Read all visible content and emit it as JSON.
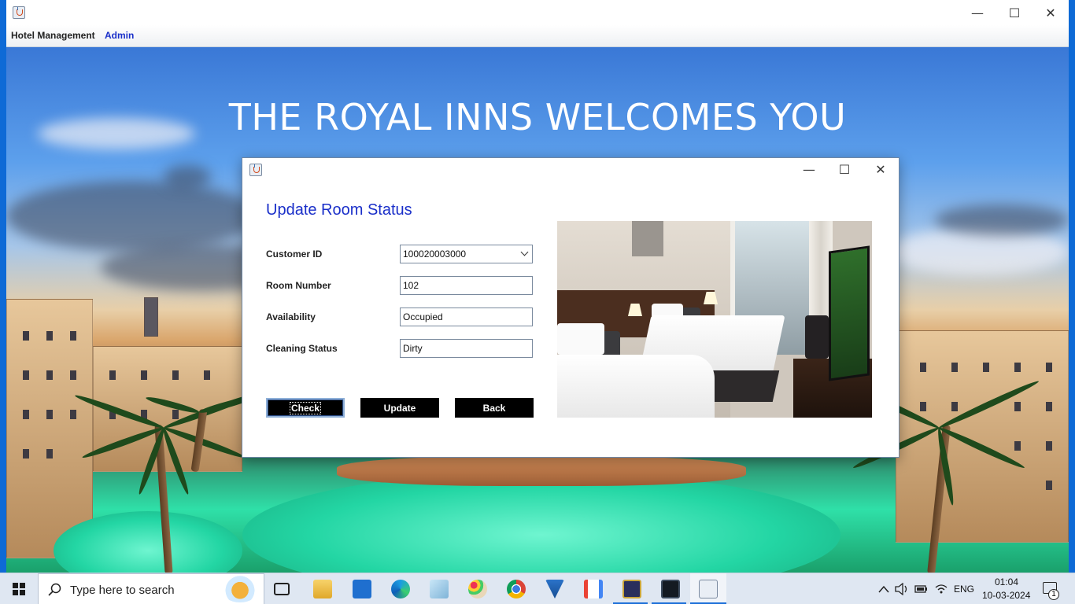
{
  "app": {
    "menu": {
      "hotel_management": "Hotel Management",
      "admin": "Admin"
    },
    "controls": {
      "minimize": "—",
      "maximize": "☐",
      "close": "✕"
    }
  },
  "banner": {
    "welcome": "THE ROYAL INNS WELCOMES YOU"
  },
  "dialog": {
    "controls": {
      "minimize": "—",
      "maximize": "☐",
      "close": "✕"
    },
    "title": "Update Room Status",
    "fields": {
      "customer_id": {
        "label": "Customer ID",
        "value": "100020003000"
      },
      "room_number": {
        "label": "Room Number",
        "value": "102"
      },
      "availability": {
        "label": "Availability",
        "value": "Occupied"
      },
      "cleaning_status": {
        "label": "Cleaning Status",
        "value": "Dirty"
      }
    },
    "buttons": {
      "check": "Check",
      "update": "Update",
      "back": "Back"
    }
  },
  "taskbar": {
    "search_placeholder": "Type here to search",
    "apps": [
      "task-view",
      "file-explorer",
      "mail",
      "edge",
      "notepad",
      "paint",
      "chrome",
      "vpn",
      "gmail",
      "photo-app",
      "mysql",
      "java"
    ],
    "tray": {
      "language": "ENG",
      "time": "01:04",
      "date": "10-03-2024",
      "notification_count": "1"
    }
  },
  "colors": {
    "accent": "#1a2fc9",
    "menu_admin": "#1a2fc9",
    "button_bg": "#000000",
    "taskbar": "#dfe7f2"
  }
}
